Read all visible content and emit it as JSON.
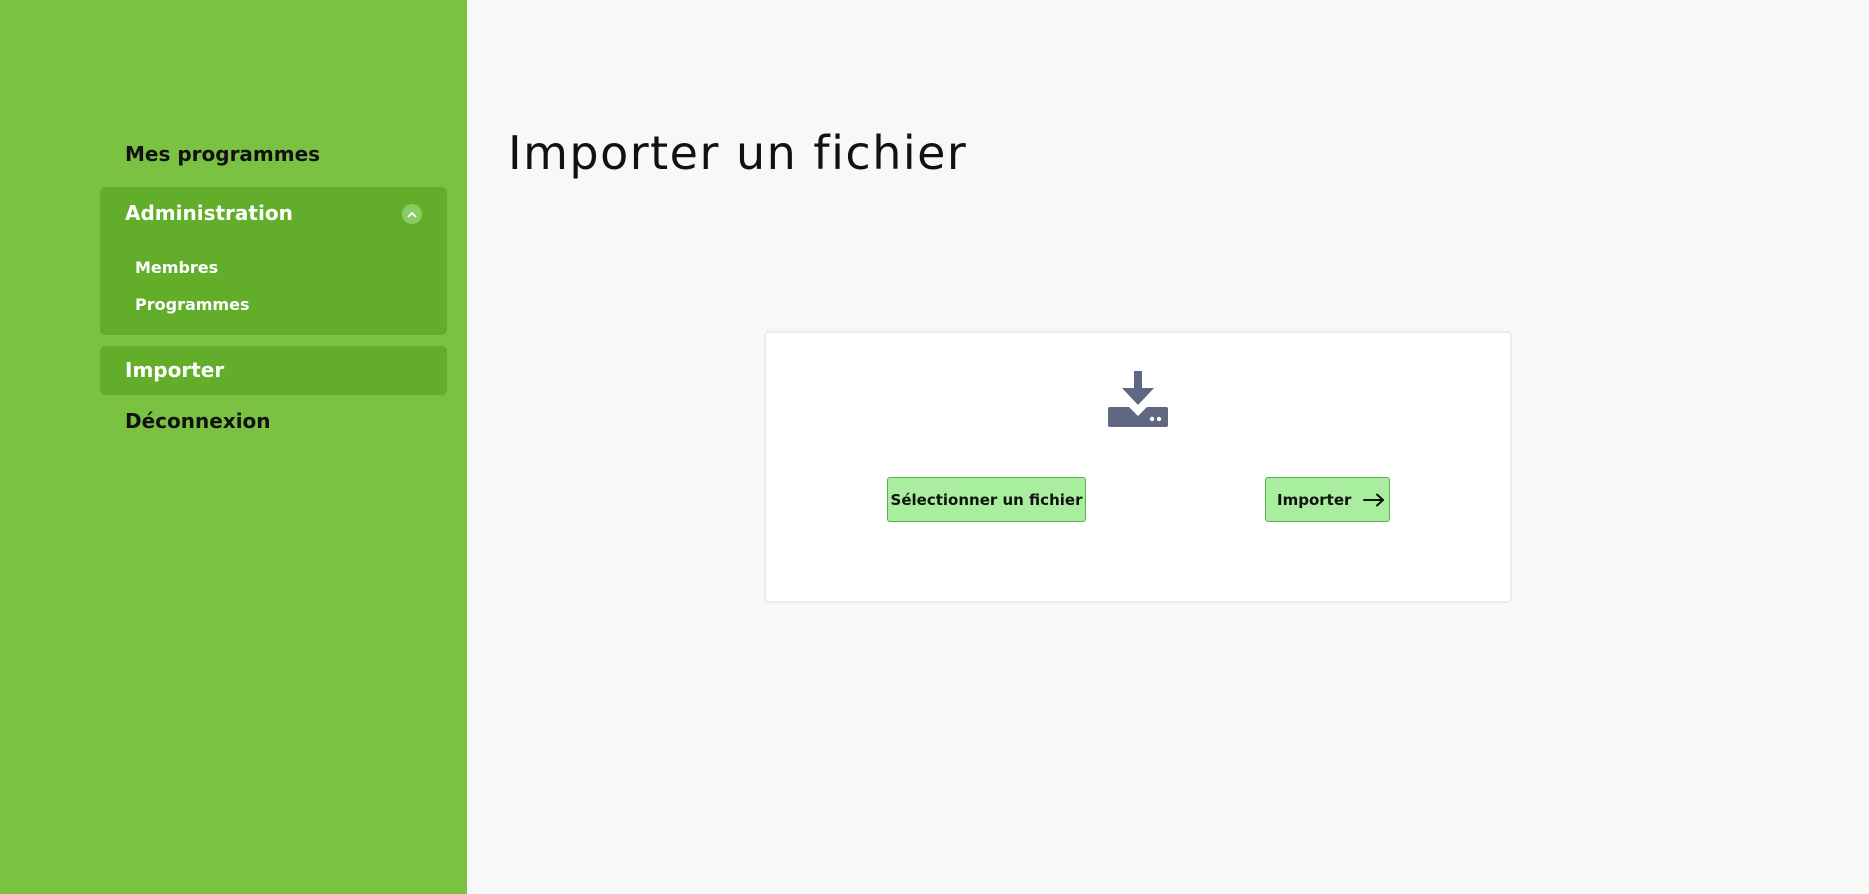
{
  "sidebar": {
    "items": {
      "programs": "Mes programmes",
      "administration": "Administration",
      "import": "Importer",
      "logout": "Déconnexion"
    },
    "admin_subitems": {
      "members": "Membres",
      "programs": "Programmes"
    }
  },
  "main": {
    "title": "Importer un fichier",
    "select_button": "Sélectionner un fichier",
    "import_button": "Importer",
    "icon": "download-tray-icon"
  },
  "colors": {
    "sidebar_bg": "#7bc242",
    "sidebar_active": "#62ae2b",
    "button_bg": "#a8ee9e",
    "icon": "#5f6781"
  }
}
